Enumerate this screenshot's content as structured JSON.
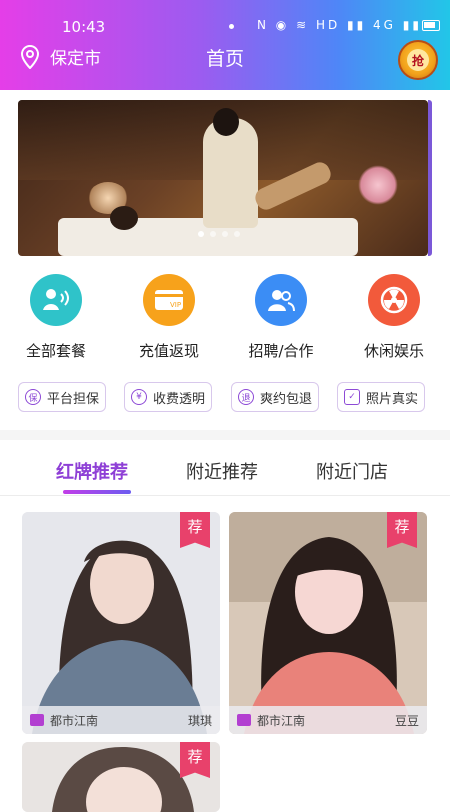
{
  "status_bar": {
    "time": "10:43",
    "icons": "N ◉ ≋ HD ▮▮ 4G ▮▮"
  },
  "header": {
    "location": "保定市",
    "title": "首页",
    "grab_label": "抢"
  },
  "banner": {
    "slide_count": 4,
    "active_slide": 0
  },
  "menu": [
    {
      "label": "全部套餐",
      "icon": "all-packages-icon",
      "color": "#2fc3c9"
    },
    {
      "label": "充值返现",
      "icon": "vip-card-icon",
      "color": "#f7a21b"
    },
    {
      "label": "招聘/合作",
      "icon": "people-icon",
      "color": "#3b8df5"
    },
    {
      "label": "休闲娱乐",
      "icon": "radiation-icon",
      "color": "#f25a3b"
    }
  ],
  "badges": [
    {
      "label": "平台担保",
      "icon_text": "保"
    },
    {
      "label": "收费透明",
      "icon_text": "¥"
    },
    {
      "label": "爽约包退",
      "icon_text": "退"
    },
    {
      "label": "照片真实",
      "icon_text": "✓"
    }
  ],
  "tabs": [
    {
      "label": "红牌推荐",
      "active": true
    },
    {
      "label": "附近推荐",
      "active": false
    },
    {
      "label": "附近门店",
      "active": false
    }
  ],
  "cards": [
    {
      "tag": "荐",
      "shop": "都市江南",
      "name": "琪琪"
    },
    {
      "tag": "荐",
      "shop": "都市江南",
      "name": "豆豆"
    },
    {
      "tag": "荐",
      "shop": "",
      "name": ""
    }
  ],
  "colors": {
    "accent": "#8e3fd6",
    "tag": "#e8416b"
  }
}
